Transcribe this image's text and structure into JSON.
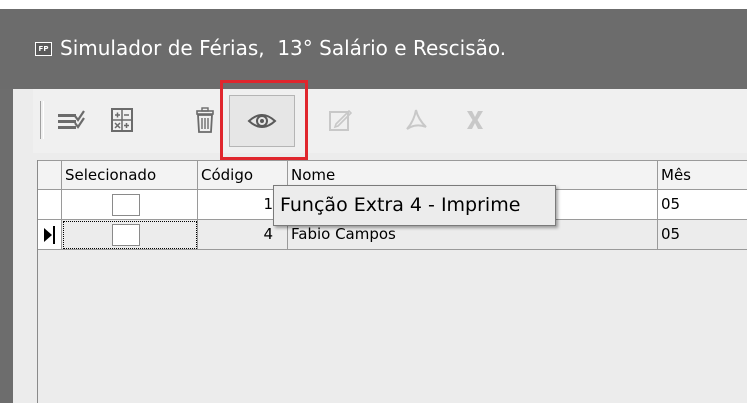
{
  "window": {
    "app_icon": "FP",
    "title": "Simulador de Férias,  13° Salário e Rescisão."
  },
  "toolbar": {
    "buttons": [
      {
        "name": "select-all-icon",
        "state": "enabled"
      },
      {
        "name": "calculator-icon",
        "state": "enabled"
      },
      {
        "name": "trash-icon",
        "state": "enabled"
      },
      {
        "name": "eye-icon",
        "state": "active"
      },
      {
        "name": "edit-icon",
        "state": "disabled"
      },
      {
        "name": "pdf-icon",
        "state": "disabled"
      },
      {
        "name": "excel-icon",
        "state": "disabled"
      }
    ]
  },
  "tooltip": "Função Extra 4 - Imprime",
  "grid": {
    "columns": [
      "Selecionado",
      "Código",
      "Nome",
      "Mês"
    ],
    "rows": [
      {
        "codigo": "1",
        "nome": "",
        "mes": "05",
        "current": false
      },
      {
        "codigo": "4",
        "nome": "Fabio Campos",
        "mes": "05",
        "current": true
      }
    ]
  },
  "colors": {
    "highlight": "#e0262d",
    "title_bar": "#6c6c6c"
  }
}
